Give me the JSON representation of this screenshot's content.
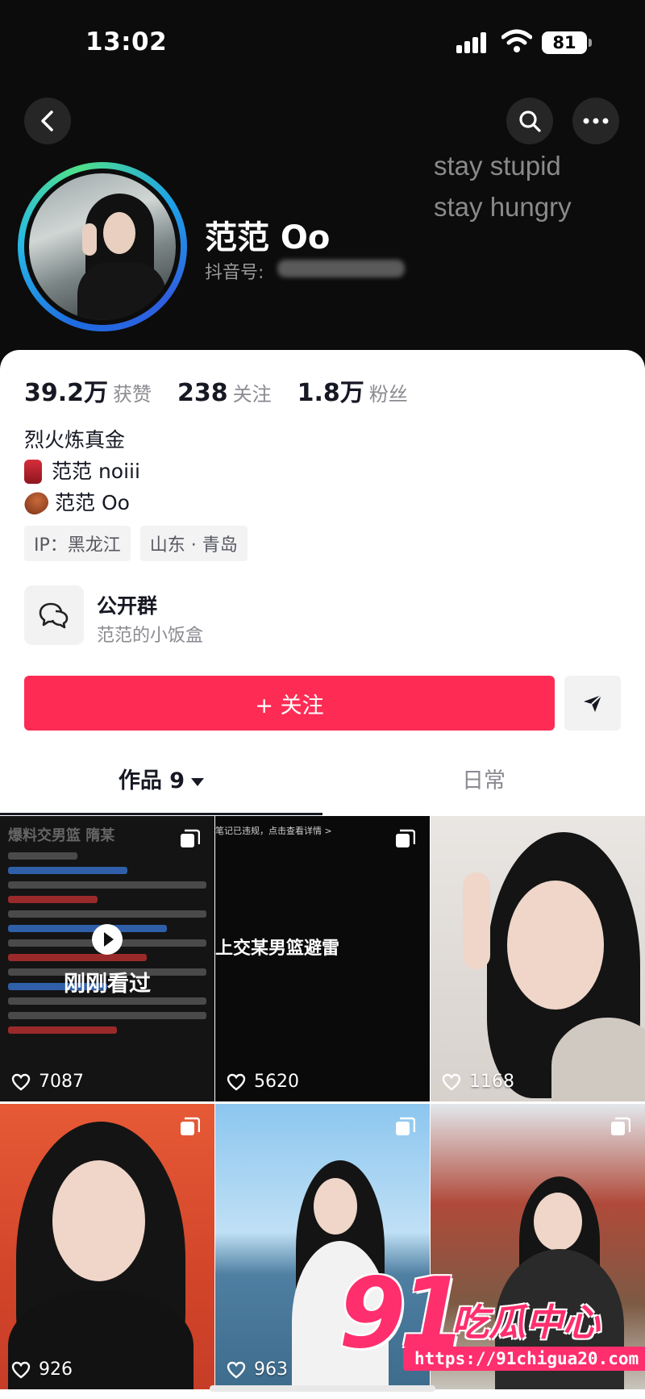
{
  "status_bar": {
    "time": "13:02",
    "battery": "81"
  },
  "header": {
    "motto_line1": "stay stupid",
    "motto_line2": "stay hungry",
    "name": "范范 Oo",
    "id_label": "抖音号:"
  },
  "stats": [
    {
      "value": "39.2万",
      "label": "获赞"
    },
    {
      "value": "238",
      "label": "关注"
    },
    {
      "value": "1.8万",
      "label": "粉丝"
    }
  ],
  "bio": {
    "line1": "烈火炼真金",
    "line2": "范范 noiii",
    "line3": "范范 Oo"
  },
  "tags": {
    "ip": "IP：黑龙江",
    "location": "山东 · 青岛"
  },
  "group": {
    "title": "公开群",
    "subtitle": "范范的小饭盒"
  },
  "follow_label": "+ 关注",
  "tabs": {
    "works": "作品 9",
    "daily": "日常"
  },
  "grid": [
    {
      "likes": "7087",
      "overlay": "刚刚看过",
      "header_text": "爆料交男篮 隋某",
      "multi": true
    },
    {
      "likes": "5620",
      "top_text": "笔记已违规，点击查看详情 >",
      "mid_text": "上交某男篮避雷",
      "multi": true
    },
    {
      "likes": "1168",
      "multi": false
    },
    {
      "likes": "926",
      "multi": true
    },
    {
      "likes": "963",
      "multi": true
    },
    {
      "likes": "",
      "multi": true
    }
  ],
  "watermark": {
    "big": "91",
    "cn": "吃瓜中心",
    "url": "https://91chigua20.com"
  }
}
